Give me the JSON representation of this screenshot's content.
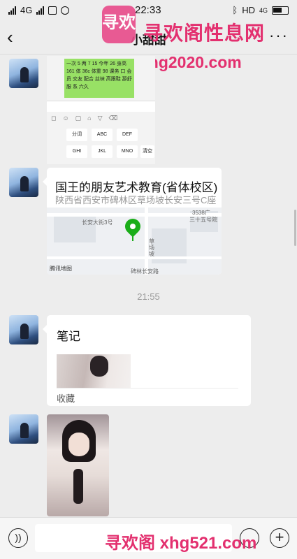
{
  "status_bar": {
    "network": "4G",
    "time": "22:33",
    "hd": "HD",
    "network_right": "4G"
  },
  "header": {
    "title": "小甜甜"
  },
  "watermark": {
    "logo_text": "寻欢",
    "site_name": "寻欢阁性息网",
    "url_top": "xhg2020.com",
    "url_bottom": "寻欢阁 xhg521.com"
  },
  "messages": [
    {
      "type": "image-screenshot",
      "text": "一次 5 两 7 15 今年 26 身高 161 体 36c 体重 98 课务 口 会员 交友 配合 丝袜 高跟鞋 舔舒服 系 六久",
      "keys": [
        "分词",
        "ABC",
        "DEF",
        "GHI",
        "JKL",
        "MNO",
        "清空"
      ]
    },
    {
      "type": "location",
      "title": "国王的朋友艺术教育(省体校区)",
      "address": "陕西省西安市碑林区草场坡长安三号C座",
      "map_labels": [
        "长安大街3号",
        "3538广",
        "三十五号院",
        "草场坡",
        "腾讯地图",
        "碑林长安路"
      ]
    },
    {
      "type": "timestamp",
      "text": "21:55"
    },
    {
      "type": "note",
      "title": "笔记",
      "source": "收藏"
    },
    {
      "type": "photo"
    }
  ],
  "input_bar": {
    "placeholder": ""
  },
  "icons": {
    "back": "chevron-left-icon",
    "more": "more-dots-icon",
    "voice": "voice-icon",
    "emoji": "emoji-icon",
    "plus": "plus-icon"
  }
}
